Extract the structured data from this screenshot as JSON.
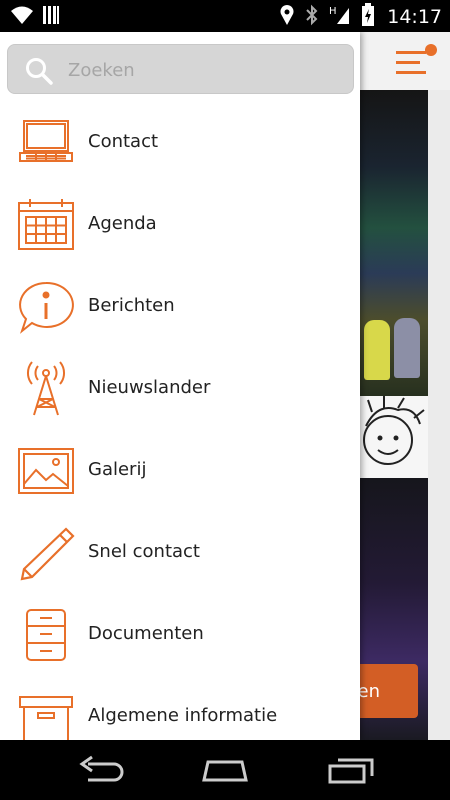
{
  "status_bar": {
    "time": "14:17",
    "icons": [
      "wifi-icon",
      "signal-bars-icon",
      "location-icon",
      "bluetooth-icon",
      "network-h-icon",
      "battery-icon"
    ]
  },
  "search": {
    "placeholder": "Zoeken",
    "value": ""
  },
  "menu": {
    "items": [
      {
        "label": "Contact",
        "icon": "laptop-icon"
      },
      {
        "label": "Agenda",
        "icon": "calendar-icon"
      },
      {
        "label": "Berichten",
        "icon": "info-bubble-icon"
      },
      {
        "label": "Nieuwslander",
        "icon": "antenna-icon"
      },
      {
        "label": "Galerij",
        "icon": "image-icon"
      },
      {
        "label": "Snel contact",
        "icon": "pencil-icon"
      },
      {
        "label": "Documenten",
        "icon": "cabinet-icon"
      },
      {
        "label": "Algemene informatie",
        "icon": "box-icon"
      }
    ]
  },
  "background_app": {
    "button_partial_label": "en"
  },
  "nav_bar": {
    "icons": [
      "back-icon",
      "home-icon",
      "recents-icon"
    ]
  },
  "colors": {
    "accent": "#e8702a",
    "drawer_bg": "#ffffff",
    "search_bg": "#d6d6d6",
    "label_text": "#222222"
  }
}
